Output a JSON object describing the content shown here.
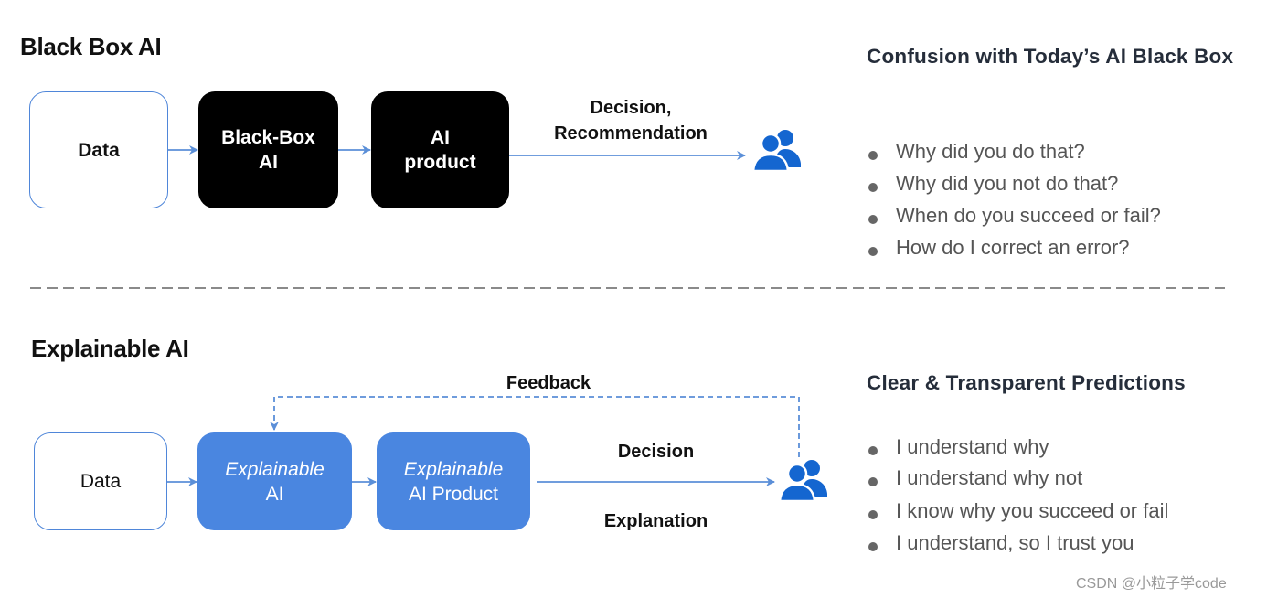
{
  "top_section": {
    "title": "Black Box AI",
    "boxes": [
      {
        "lines": [
          "Data"
        ]
      },
      {
        "lines": [
          "Black-Box",
          "AI"
        ]
      },
      {
        "lines": [
          "AI",
          "product"
        ]
      }
    ],
    "output_label": [
      "Decision,",
      "Recommendation"
    ],
    "user_icon": "users-icon"
  },
  "top_panel": {
    "title": "Confusion with Today’s AI Black Box",
    "bullets": [
      "Why did you do that?",
      "Why did you not do that?",
      "When do you succeed or fail?",
      "How do I correct an error?"
    ]
  },
  "bottom_section": {
    "title": "Explainable AI",
    "feedback_label": "Feedback",
    "boxes": [
      {
        "lines": [
          "Data"
        ]
      },
      {
        "lines": [
          "Explainable",
          "AI"
        ]
      },
      {
        "lines": [
          "Explainable",
          "AI Product"
        ]
      }
    ],
    "output_label_top": "Decision",
    "output_label_bottom": "Explanation",
    "user_icon": "users-icon"
  },
  "bottom_panel": {
    "title": "Clear & Transparent Predictions",
    "bullets": [
      "I understand why",
      "I understand why not",
      "I know why you succeed or fail",
      "I understand, so I trust you"
    ]
  },
  "watermark": "CSDN @小粒子学code",
  "colors": {
    "accent_blue": "#4a86e0",
    "arrow_blue": "#5b8fd8",
    "icon_blue": "#1466d0",
    "black_box": "#000000",
    "divider_gray": "#8a8a8a"
  }
}
